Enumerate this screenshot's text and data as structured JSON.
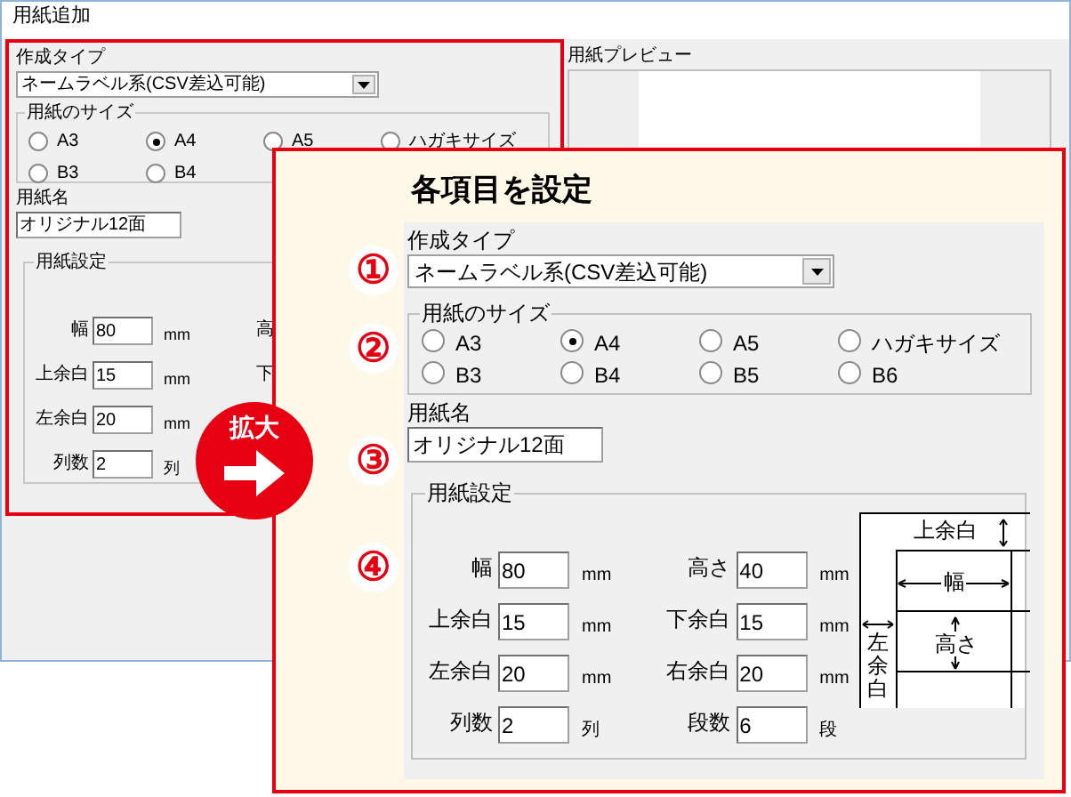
{
  "window": {
    "title": "用紙追加"
  },
  "form": {
    "type_label": "作成タイプ",
    "type_value": "ネームラベル系(CSV差込可能)",
    "size_label": "用紙のサイズ",
    "sizes": [
      [
        {
          "label": "A3",
          "selected": false
        },
        {
          "label": "A4",
          "selected": true
        },
        {
          "label": "A5",
          "selected": false
        },
        {
          "label": "ハガキサイズ",
          "selected": false
        }
      ],
      [
        {
          "label": "B3",
          "selected": false
        },
        {
          "label": "B4",
          "selected": false
        }
      ]
    ],
    "name_label": "用紙名",
    "name_value": "オリジナル12面",
    "settings_label": "用紙設定",
    "fields": [
      {
        "label": "幅",
        "value": "80",
        "unit": "mm"
      },
      {
        "label": "上余白",
        "value": "15",
        "unit": "mm"
      },
      {
        "label": "左余白",
        "value": "20",
        "unit": "mm"
      },
      {
        "label": "列数",
        "value": "2",
        "unit": "列"
      }
    ],
    "right_labels": [
      "高",
      "下"
    ]
  },
  "preview": {
    "label": "用紙プレビュー"
  },
  "badge": "拡大",
  "callout": {
    "title": "各項目を設定",
    "steps": [
      "①",
      "②",
      "③",
      "④"
    ],
    "type_label": "作成タイプ",
    "type_value": "ネームラベル系(CSV差込可能)",
    "size_label": "用紙のサイズ",
    "sizes": [
      [
        {
          "label": "A3",
          "selected": false
        },
        {
          "label": "A4",
          "selected": true
        },
        {
          "label": "A5",
          "selected": false
        },
        {
          "label": "ハガキサイズ",
          "selected": false
        }
      ],
      [
        {
          "label": "B3",
          "selected": false
        },
        {
          "label": "B4",
          "selected": false
        },
        {
          "label": "B5",
          "selected": false
        },
        {
          "label": "B6",
          "selected": false
        }
      ]
    ],
    "name_label": "用紙名",
    "name_value": "オリジナル12面",
    "settings_label": "用紙設定",
    "left": [
      {
        "label": "幅",
        "value": "80",
        "unit": "mm"
      },
      {
        "label": "上余白",
        "value": "15",
        "unit": "mm"
      },
      {
        "label": "左余白",
        "value": "20",
        "unit": "mm"
      },
      {
        "label": "列数",
        "value": "2",
        "unit": "列"
      }
    ],
    "right": [
      {
        "label": "高さ",
        "value": "40",
        "unit": "mm"
      },
      {
        "label": "下余白",
        "value": "15",
        "unit": "mm"
      },
      {
        "label": "右余白",
        "value": "20",
        "unit": "mm"
      },
      {
        "label": "段数",
        "value": "6",
        "unit": "段"
      }
    ],
    "diagram": {
      "top_margin": "上余白",
      "width": "幅",
      "height": "高さ",
      "left_margin": "左余白"
    }
  }
}
